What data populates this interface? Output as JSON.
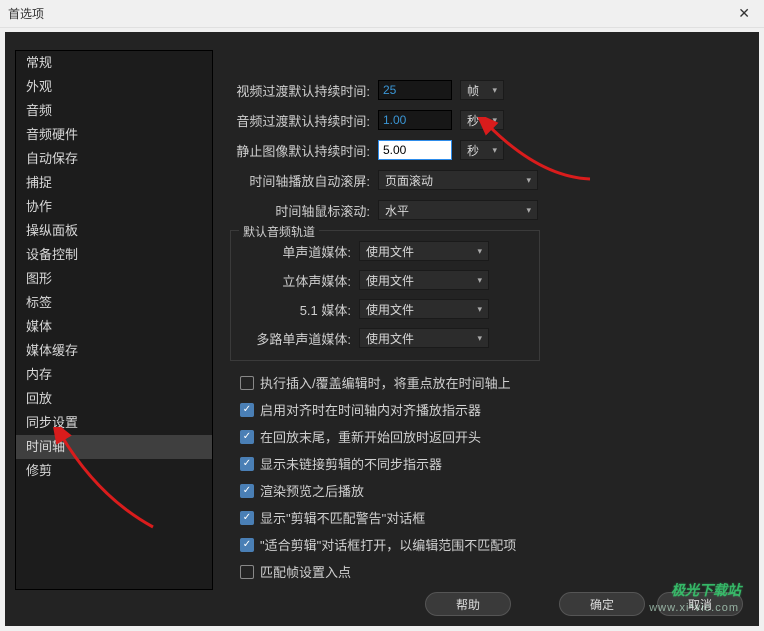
{
  "title": "首选项",
  "close_glyph": "✕",
  "sidebar": {
    "items": [
      "常规",
      "外观",
      "音频",
      "音频硬件",
      "自动保存",
      "捕捉",
      "协作",
      "操纵面板",
      "设备控制",
      "图形",
      "标签",
      "媒体",
      "媒体缓存",
      "内存",
      "回放",
      "同步设置",
      "时间轴",
      "修剪"
    ],
    "selected": 16
  },
  "fields": {
    "video_trans": {
      "label": "视频过渡默认持续时间:",
      "value": "25",
      "unit": "帧"
    },
    "audio_trans": {
      "label": "音频过渡默认持续时间:",
      "value": "1.00",
      "unit": "秒"
    },
    "still_image": {
      "label": "静止图像默认持续时间:",
      "value": "5.00",
      "unit": "秒"
    },
    "playback_scroll": {
      "label": "时间轴播放自动滚屏:",
      "value": "页面滚动"
    },
    "mouse_scroll": {
      "label": "时间轴鼠标滚动:",
      "value": "水平"
    }
  },
  "fieldset": {
    "legend": "默认音频轨道",
    "mono": {
      "label": "单声道媒体:",
      "value": "使用文件"
    },
    "stereo": {
      "label": "立体声媒体:",
      "value": "使用文件"
    },
    "fiveone": {
      "label": "5.1 媒体:",
      "value": "使用文件"
    },
    "multi": {
      "label": "多路单声道媒体:",
      "value": "使用文件"
    }
  },
  "checks": [
    {
      "label": "执行插入/覆盖编辑时，将重点放在时间轴上",
      "checked": false
    },
    {
      "label": "启用对齐时在时间轴内对齐播放指示器",
      "checked": true
    },
    {
      "label": "在回放末尾，重新开始回放时返回开头",
      "checked": true
    },
    {
      "label": "显示未链接剪辑的不同步指示器",
      "checked": true
    },
    {
      "label": "渲染预览之后播放",
      "checked": true
    },
    {
      "label": "显示\"剪辑不匹配警告\"对话框",
      "checked": true
    },
    {
      "label": "\"适合剪辑\"对话框打开，以编辑范围不匹配项",
      "checked": true
    },
    {
      "label": "匹配帧设置入点",
      "checked": false
    }
  ],
  "buttons": {
    "help": "帮助",
    "ok": "确定",
    "cancel": "取消"
  },
  "watermark": {
    "brand": "极光下载站",
    "url": "www.xi*vic.com"
  }
}
